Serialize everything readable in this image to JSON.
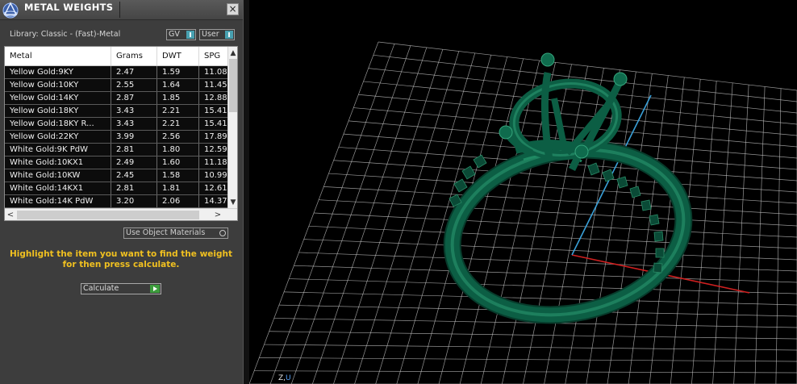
{
  "panel": {
    "title": "METAL WEIGHTS",
    "close_glyph": "×",
    "library_label": "Library: Classic - (Fast)-Metal",
    "gv_toggle": "GV",
    "user_toggle": "User",
    "columns": [
      "Metal",
      "Grams",
      "DWT",
      "SPG"
    ],
    "rows": [
      [
        "Yellow Gold:9KY",
        "2.47",
        "1.59",
        "11.08"
      ],
      [
        "Yellow Gold:10KY",
        "2.55",
        "1.64",
        "11.45"
      ],
      [
        "Yellow Gold:14KY",
        "2.87",
        "1.85",
        "12.88"
      ],
      [
        "Yellow Gold:18KY",
        "3.43",
        "2.21",
        "15.41"
      ],
      [
        "Yellow Gold:18KY R...",
        "3.43",
        "2.21",
        "15.41"
      ],
      [
        "Yellow Gold:22KY",
        "3.99",
        "2.56",
        "17.89"
      ],
      [
        "White Gold:9K PdW",
        "2.81",
        "1.80",
        "12.59"
      ],
      [
        "White Gold:10KX1",
        "2.49",
        "1.60",
        "11.18"
      ],
      [
        "White Gold:10KW",
        "2.45",
        "1.58",
        "10.99"
      ],
      [
        "White Gold:14KX1",
        "2.81",
        "1.81",
        "12.61"
      ],
      [
        "White Gold:14K PdW",
        "3.20",
        "2.06",
        "14.37"
      ]
    ],
    "use_object_materials": "Use Object Materials",
    "instructions": "Highlight the item you want to find the weight for then press calculate.",
    "calculate": "Calculate",
    "scroll_up": "▲",
    "scroll_down": "▼",
    "scroll_left": "<",
    "scroll_right": ">"
  },
  "viewport": {
    "axis_label_z": "Z,",
    "axis_label_u": "U",
    "colors": {
      "grid": "#c8c8c8",
      "x_axis": "#d02020",
      "y_axis": "#3aa0d8",
      "model": "#0c5e44"
    }
  },
  "icons": {
    "app_logo": "triangle-logo-icon",
    "close": "close-icon",
    "calculate_go": "play-icon"
  }
}
